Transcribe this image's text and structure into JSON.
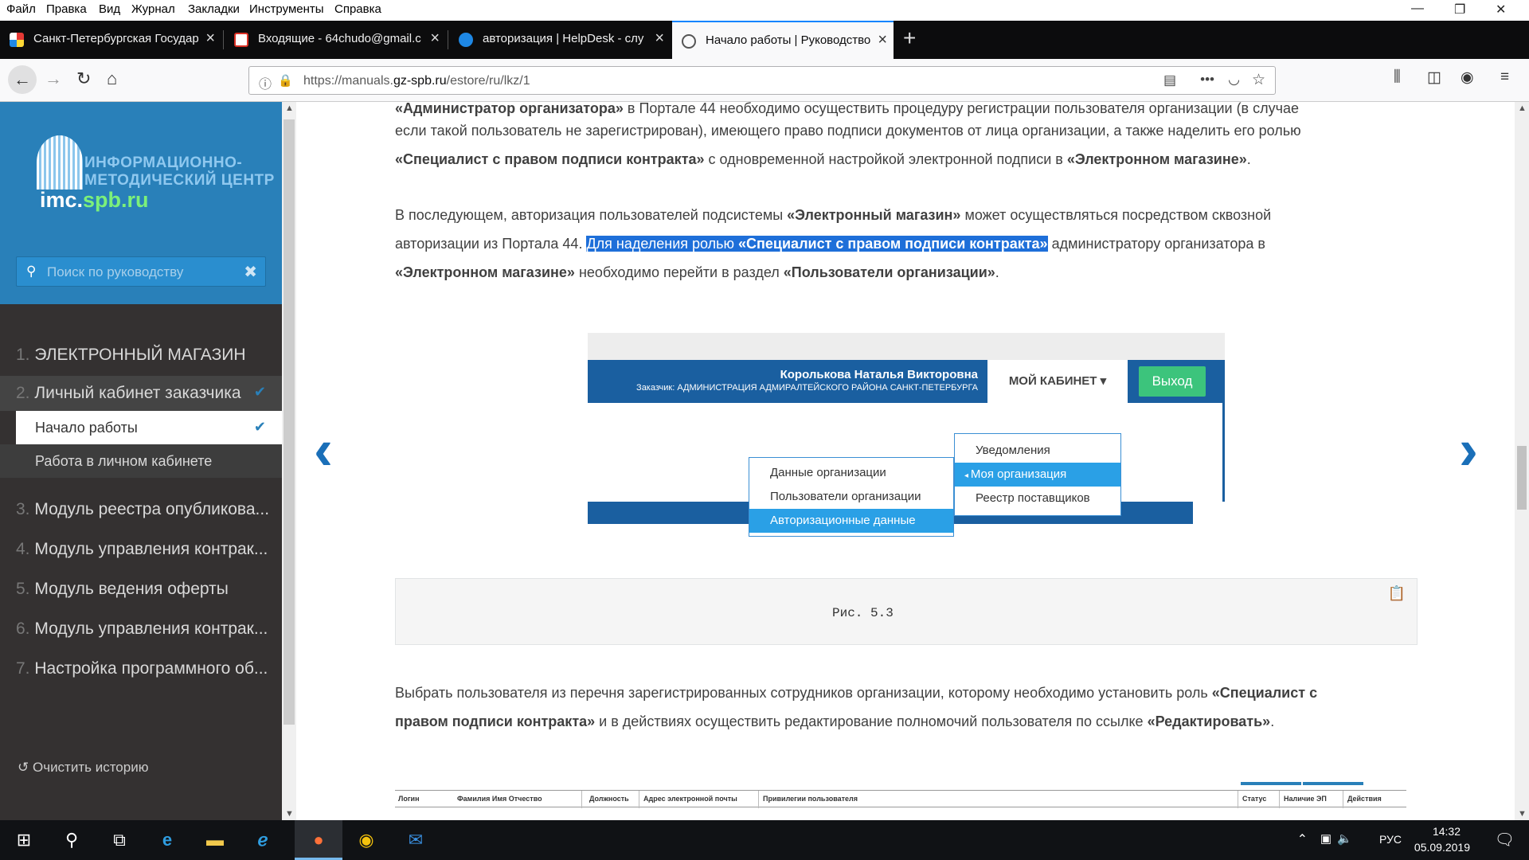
{
  "menubar": {
    "items": [
      "Файл",
      "Правка",
      "Вид",
      "Журнал",
      "Закладки",
      "Инструменты",
      "Справка"
    ]
  },
  "window_controls": {
    "minimize": "—",
    "maximize": "❐",
    "close": "✕"
  },
  "tabs": [
    {
      "title": "Санкт-Петербургская Государ",
      "favicon": "spb-icon",
      "active": false
    },
    {
      "title": "Входящие - 64chudo@gmail.c",
      "favicon": "gmail-icon",
      "active": false
    },
    {
      "title": "авторизация | HelpDesk - слу",
      "favicon": "helpdesk-icon",
      "active": false
    },
    {
      "title": "Начало работы | Руководство",
      "favicon": "manual-icon",
      "active": true
    }
  ],
  "url": {
    "prefix": "https://manuals.",
    "domain": "gz-spb.ru",
    "path": "/estore/ru/lkz/1"
  },
  "sidebar": {
    "logo": {
      "line1": "ИНФОРМАЦИОННО-",
      "line2": "МЕТОДИЧЕСКИЙ ЦЕНТР",
      "brand_a": "imc.",
      "brand_b": "spb.ru"
    },
    "search_placeholder": "Поиск по руководству",
    "items": [
      {
        "num": "1.",
        "label": "ЭЛЕКТРОННЫЙ МАГАЗИН"
      },
      {
        "num": "2.",
        "label": "Личный кабинет заказчика",
        "checked": true
      },
      {
        "num": "",
        "label": "Начало работы",
        "checked": true,
        "current": true
      },
      {
        "num": "",
        "label": "Работа в личном кабинете"
      },
      {
        "num": "3.",
        "label": "Модуль реестра опубликова..."
      },
      {
        "num": "4.",
        "label": "Модуль управления контрак..."
      },
      {
        "num": "5.",
        "label": "Модуль ведения оферты"
      },
      {
        "num": "6.",
        "label": "Модуль управления контрак..."
      },
      {
        "num": "7.",
        "label": "Настройка программного об..."
      }
    ],
    "clear_history": "Очистить историю"
  },
  "content": {
    "p1_l1a": "«Администратор организатора»",
    "p1_l1b": " в Портале 44 необходимо осуществить процедуру регистрации пользователя организации (в случае",
    "p1_l2": "если такой пользователь не зарегистрирован), имеющего право подписи документов от лица организации, а также наделить его ролью",
    "p1_l3a": "«Специалист с правом подписи контракта»",
    "p1_l3b": " с одновременной настройкой электронной подписи в ",
    "p1_l3c": "«Электронном магазине»",
    "p1_l3d": ".",
    "p2_l1a": "В последующем, авторизация пользователей подсистемы ",
    "p2_l1b": "«Электронный магазин»",
    "p2_l1c": " может осуществляться посредством сквозной",
    "p2_l2a": "авторизации из Портала 44. ",
    "p2_l2b": "Для наделения ролью ",
    "p2_l2c": "«Специалист с правом подписи контракта»",
    "p2_l2d": " администратору организатора в",
    "p2_l3a": "«Электронном магазине»",
    "p2_l3b": " необходимо перейти в раздел ",
    "p2_l3c": "«Пользователи организации»",
    "p2_l3d": ".",
    "figure": {
      "user_name": "Королькова Наталья Викторовна",
      "customer": "Заказчик: АДМИНИСТРАЦИЯ АДМИРАЛТЕЙСКОГО РАЙОНА САНКТ-ПЕТЕРБУРГА",
      "cabinet": "МОЙ КАБИНЕТ",
      "exit": "Выход",
      "menu_right": [
        "Уведомления",
        "Моя организация",
        "Реестр поставщиков"
      ],
      "menu_left": [
        "Данные организации",
        "Пользователи организации",
        "Авторизационные данные"
      ]
    },
    "caption": "Рис. 5.3",
    "p3_l1a": "Выбрать пользователя из перечня зарегистрированных сотрудников организации, которому необходимо установить роль ",
    "p3_l1b": "«Специалист с",
    "p3_l2a": "правом подписи контракта»",
    "p3_l2b": " и в действиях осуществить редактирование полномочий пользователя по ссылке ",
    "p3_l2c": "«Редактировать»",
    "p3_l2d": ".",
    "table_headers": [
      "Логин",
      "Фамилия Имя Отчество",
      "Должность",
      "Адрес электронной почты",
      "Привилегии пользователя",
      "Статус",
      "Наличие ЭП",
      "Действия"
    ]
  },
  "taskbar": {
    "lang": "РУС",
    "time": "14:32",
    "date": "05.09.2019"
  },
  "colors": {
    "accent": "#2980b9",
    "sidebar_bg": "#343131",
    "highlight": "#1e6fd9",
    "arrow": "#1a6fb8"
  }
}
